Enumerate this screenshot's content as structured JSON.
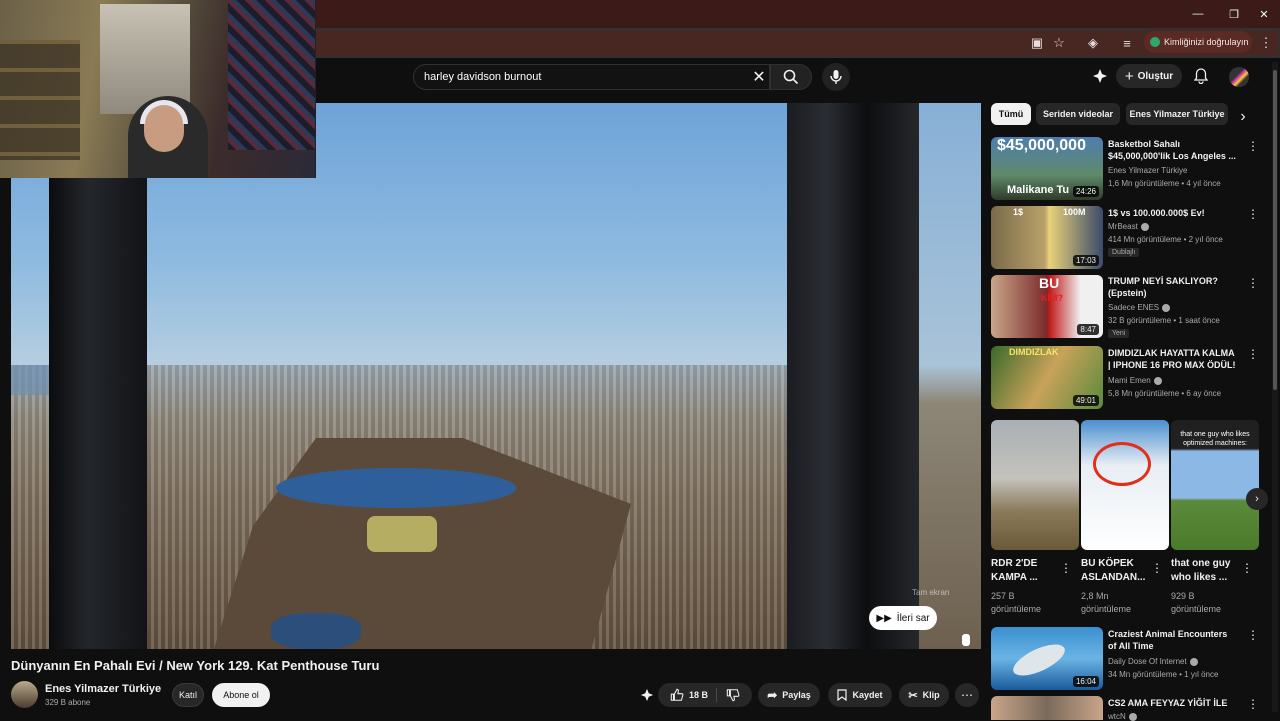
{
  "browser": {
    "profile_chip": "Kimliğinizi doğrulayın"
  },
  "search": {
    "query": "harley davidson burnout"
  },
  "header": {
    "create_label": "Oluştur"
  },
  "video": {
    "title": "Dünyanın En Pahalı Evi / New York 129. Kat Penthouse Turu",
    "skip_label": "İleri sar",
    "watermark": "Tam ekran",
    "channel": "Enes Yilmazer Türkiye",
    "subscribers": "329 B abone",
    "join_label": "Katıl",
    "subscribe_label": "Abone ol",
    "likes": "18 B",
    "share_label": "Paylaş",
    "save_label": "Kaydet",
    "clip_label": "Klip"
  },
  "chips": [
    "Tümü",
    "Seriden videolar",
    "Enes Yilmazer Türkiye"
  ],
  "recommendations": [
    {
      "title": "Basketbol Sahalı $45,000,000'lik Los Angeles ...",
      "thumb_text": "$45,000,000",
      "thumb_sub": "Malikane Tu",
      "duration": "24:26",
      "channel": "Enes Yilmazer Türkiye",
      "verified": false,
      "meta": "1,6 Mn görüntüleme • 4 yıl önce",
      "badge": ""
    },
    {
      "title": "1$ vs 100.000.000$ Ev!",
      "thumb_text": "1$",
      "thumb_sub": "100M",
      "duration": "17:03",
      "channel": "MrBeast",
      "verified": true,
      "meta": "414 Mn görüntüleme • 2 yıl önce",
      "badge": "Dublajlı"
    },
    {
      "title": "TRUMP NEYİ SAKLIYOR? (Epstein)",
      "thumb_text": "BU",
      "thumb_sub": "KİM?",
      "duration": "8:47",
      "channel": "Sadece ENES",
      "verified": true,
      "meta": "32 B görüntüleme • 1 saat önce",
      "badge": "Yeni"
    },
    {
      "title": "DIMDIZLAK HAYATTA KALMA | IPHONE 16 PRO MAX ÖDÜL!",
      "thumb_text": "DIMDIZLAK",
      "thumb_sub": "",
      "duration": "49:01",
      "channel": "Mami Emen",
      "verified": true,
      "meta": "5,8 Mn görüntüleme • 6 ay önce",
      "badge": ""
    },
    {
      "title": "Craziest Animal Encounters of All Time",
      "thumb_text": "",
      "thumb_sub": "",
      "duration": "16:04",
      "channel": "Daily Dose Of Internet",
      "verified": true,
      "meta": "34 Mn görüntüleme • 1 yıl önce",
      "badge": ""
    },
    {
      "title": "CS2 AMA FEYYAZ YİĞİT İLE",
      "thumb_text": "",
      "thumb_sub": "",
      "duration": "",
      "channel": "wtcN",
      "verified": true,
      "meta": "",
      "badge": ""
    }
  ],
  "shorts": [
    {
      "title": "RDR 2'DE KAMPA ...",
      "views": "257 B görüntüleme",
      "overlay": ""
    },
    {
      "title": "BU KÖPEK ASLANDAN...",
      "views": "2,8 Mn görüntüleme",
      "overlay": ""
    },
    {
      "title": "that one guy who likes ...",
      "views": "929 B görüntüleme",
      "overlay": "that one guy who likes optimized machines:"
    }
  ],
  "colors": {
    "chrome_title": "#3b1a17",
    "yt_bg": "#0f0f0f",
    "chip_active": "#f1f1f1"
  }
}
